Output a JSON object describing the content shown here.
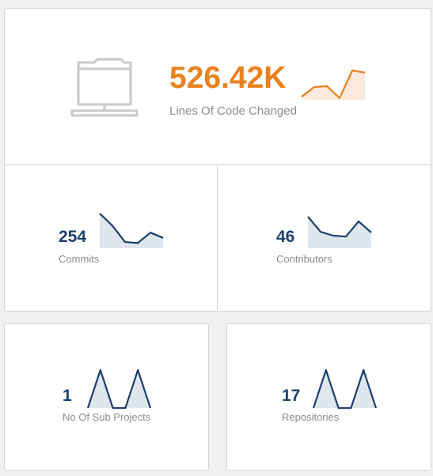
{
  "colors": {
    "accent_orange": "#e8821e",
    "navy": "#1d3f6e",
    "spark_fill_orange": "#fbeadb",
    "spark_fill_blue": "#dfe6ec",
    "icon_gray": "#c9c9c9"
  },
  "main_stat": {
    "icon": "folder-network-icon",
    "value": "526.42K",
    "label": "Lines Of Code Changed",
    "spark": [
      0.1,
      0.42,
      0.45,
      0.05,
      0.97,
      0.9
    ]
  },
  "commits": {
    "value": "254",
    "label": "Commits",
    "spark": [
      1.0,
      0.65,
      0.18,
      0.15,
      0.45,
      0.3
    ]
  },
  "contributors": {
    "value": "46",
    "label": "Contributors",
    "spark": [
      1.0,
      0.52,
      0.4,
      0.37,
      0.85,
      0.5
    ]
  },
  "sub_projects": {
    "value": "1",
    "label": "No Of Sub Projects",
    "spark": [
      0,
      1,
      0,
      0,
      1,
      0
    ]
  },
  "repositories": {
    "value": "17",
    "label": "Repositories",
    "spark": [
      0,
      1,
      0,
      0,
      1,
      0
    ]
  }
}
